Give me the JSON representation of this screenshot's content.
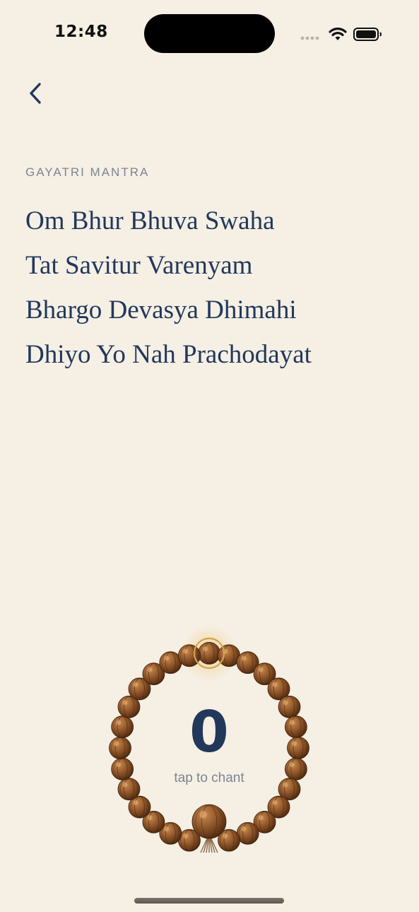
{
  "status_bar": {
    "time": "12:48",
    "icons": [
      "signal-icon",
      "wifi-icon",
      "battery-icon"
    ]
  },
  "nav": {
    "back_icon": "chevron-left-icon"
  },
  "mantra": {
    "label": "GAYATRI MANTRA",
    "lines": [
      "Om Bhur Bhuva Swaha",
      "Tat Savitur Varenyam",
      "Bhargo Devasya Dhimahi",
      "Dhiyo Yo Nah Prachodayat"
    ]
  },
  "counter": {
    "count": "0",
    "hint": "tap to chant"
  },
  "colors": {
    "background": "#f5efe4",
    "text_primary": "#21385a",
    "text_muted": "#7c8594",
    "bead": "#8a5228",
    "bead_highlight": "#c9a255"
  }
}
